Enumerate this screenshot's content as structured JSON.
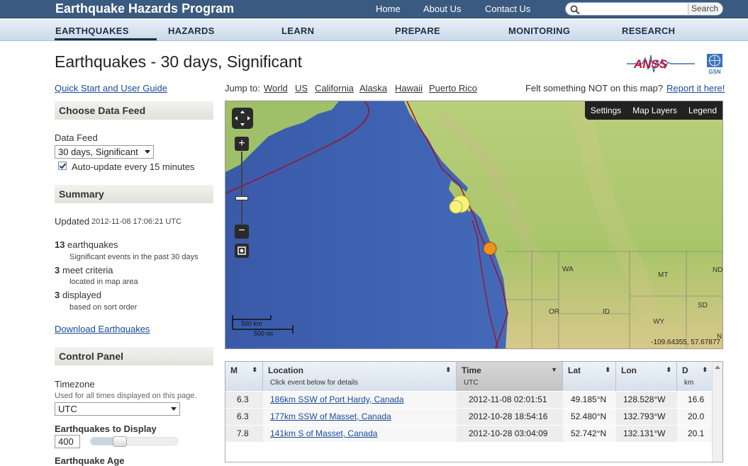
{
  "header": {
    "site_title": "Earthquake Hazards Program",
    "links": [
      "Home",
      "About Us",
      "Contact Us"
    ],
    "search_placeholder": "",
    "search_button": "Search"
  },
  "nav": {
    "items": [
      "EARTHQUAKES",
      "HAZARDS",
      "LEARN",
      "PREPARE",
      "MONITORING",
      "RESEARCH"
    ],
    "active": "EARTHQUAKES"
  },
  "page": {
    "title": "Earthquakes - 30 days, Significant",
    "anss_logo": "ANSS",
    "gsn_logo": "GSN"
  },
  "sidebar": {
    "quick_start": "Quick Start and User Guide",
    "choose_feed_heading": "Choose Data Feed",
    "data_feed_label": "Data Feed",
    "data_feed_value": "30 days, Significant",
    "autoupdate_label": "Auto-update every 15 minutes",
    "autoupdate_checked": true,
    "summary_heading": "Summary",
    "updated_label": "Updated",
    "updated_value": "2012-11-08 17:06:21 UTC",
    "total_count": "13",
    "total_label": "earthquakes",
    "total_sub": "Significant events in the past 30 days",
    "criteria_count": "3",
    "criteria_label": "meet criteria",
    "criteria_sub": "located in map area",
    "displayed_count": "3",
    "displayed_label": "displayed",
    "displayed_sub": "based on sort order",
    "download": "Download Earthquakes",
    "control_heading": "Control Panel",
    "timezone_label": "Timezone",
    "timezone_sub": "Used for all times displayed on this page.",
    "timezone_value": "UTC",
    "display_label": "Earthquakes to Display",
    "display_value": "400",
    "display_slider_fraction": 0.3,
    "age_label": "Earthquake Age"
  },
  "jump": {
    "label": "Jump to:",
    "links": [
      "World",
      "US",
      "California",
      "Alaska",
      "Hawaii",
      "Puerto Rico"
    ],
    "felt_text": "Felt something NOT on this map?",
    "report_link": "Report it here!"
  },
  "map": {
    "tools": [
      "Settings",
      "Map Layers",
      "Legend"
    ],
    "coords": "-109.64355, 57.67877",
    "scale_km": "500 km",
    "scale_mi": "500 mi",
    "states": [
      "WA",
      "MT",
      "ND",
      "OR",
      "ID",
      "SD",
      "WY",
      "NE"
    ],
    "colors": {
      "ocean": "#3f63b5",
      "land": "#a8c86a",
      "plate": "#a0102a",
      "quake_yellow": "#f7f37a",
      "quake_orange": "#f0901e"
    }
  },
  "table": {
    "headers": [
      {
        "label": "M",
        "sub": ""
      },
      {
        "label": "Location",
        "sub": "Click event below for details"
      },
      {
        "label": "Time",
        "sub": "UTC"
      },
      {
        "label": "Lat",
        "sub": ""
      },
      {
        "label": "Lon",
        "sub": ""
      },
      {
        "label": "D",
        "sub": "km"
      }
    ],
    "rows": [
      {
        "m": "6.3",
        "location": "186km SSW of Port Hardy, Canada",
        "time": "2012-11-08 02:01:51",
        "lat": "49.185°N",
        "lon": "128.528°W",
        "depth": "16.6"
      },
      {
        "m": "6.3",
        "location": "177km SSW of Masset, Canada",
        "time": "2012-10-28 18:54:16",
        "lat": "52.480°N",
        "lon": "132.793°W",
        "depth": "20.0"
      },
      {
        "m": "7.8",
        "location": "141km S of Masset, Canada",
        "time": "2012-10-28 03:04:09",
        "lat": "52.742°N",
        "lon": "132.131°W",
        "depth": "20.1"
      }
    ]
  }
}
